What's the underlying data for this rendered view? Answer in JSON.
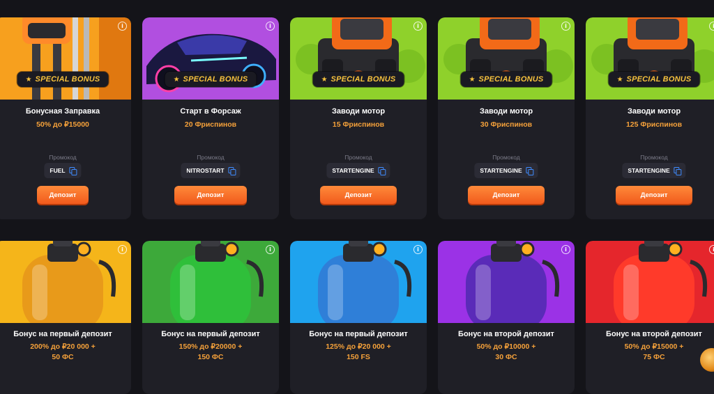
{
  "row1": [
    {
      "title": "Бонусная Заправка",
      "offer": "50% до ₽15000",
      "special": true,
      "promo_label": "Промокод",
      "promo": "FUEL",
      "button": "Депозит",
      "art": "fuel-pump",
      "bg": "#f7a01e"
    },
    {
      "title": "Старт в Форсаж",
      "offer": "20 Фриспинов",
      "special": true,
      "promo_label": "Промокод",
      "promo": "NITROSTART",
      "button": "Депозит",
      "art": "car",
      "bg": "#b14fe0"
    },
    {
      "title": "Заводи мотор",
      "offer": "15 Фриспинов",
      "special": true,
      "promo_label": "Промокод",
      "promo": "STARTENGINE",
      "button": "Депозит",
      "art": "engine",
      "bg": "#8fd12b"
    },
    {
      "title": "Заводи мотор",
      "offer": "30 Фриспинов",
      "special": true,
      "promo_label": "Промокод",
      "promo": "STARTENGINE",
      "button": "Депозит",
      "art": "engine",
      "bg": "#8fd12b"
    },
    {
      "title": "Заводи мотор",
      "offer": "125 Фриспинов",
      "special": true,
      "promo_label": "Промокод",
      "promo": "STARTENGINE",
      "button": "Депозит",
      "art": "engine",
      "bg": "#8fd12b"
    }
  ],
  "row2": [
    {
      "title": "Бонус на первый депозит",
      "offer": "200% до ₽20 000 +",
      "offer2": "50 ФС",
      "art": "tank",
      "bg": "#f5b51a",
      "tank": "#e89a1a"
    },
    {
      "title": "Бонус на первый депозит",
      "offer": "150% до ₽20000 +",
      "offer2": "150 ФС",
      "art": "tank",
      "bg": "#3da93a",
      "tank": "#2fbf3a"
    },
    {
      "title": "Бонус на первый депозит",
      "offer": "125% до ₽20 000 +",
      "offer2": "150 FS",
      "art": "tank",
      "bg": "#1fa3ee",
      "tank": "#2f7fd8"
    },
    {
      "title": "Бонус на второй депозит",
      "offer": "50% до ₽10000 +",
      "offer2": "30 ФС",
      "art": "tank",
      "bg": "#9b32e6",
      "tank": "#5a2bb8"
    },
    {
      "title": "Бонус на второй депозит",
      "offer": "50% до ₽15000 +",
      "offer2": "75 ФС",
      "art": "tank",
      "bg": "#e5262c",
      "tank": "#ff3a2a"
    }
  ],
  "special_label": "SPECIAL BONUS",
  "info_glyph": "i",
  "star_glyph": "★",
  "colors": {
    "accent": "#f5a13a",
    "button": "#f15a1c",
    "card": "#1f1f26",
    "page": "#141419",
    "badge_text": "#f7c23d"
  }
}
